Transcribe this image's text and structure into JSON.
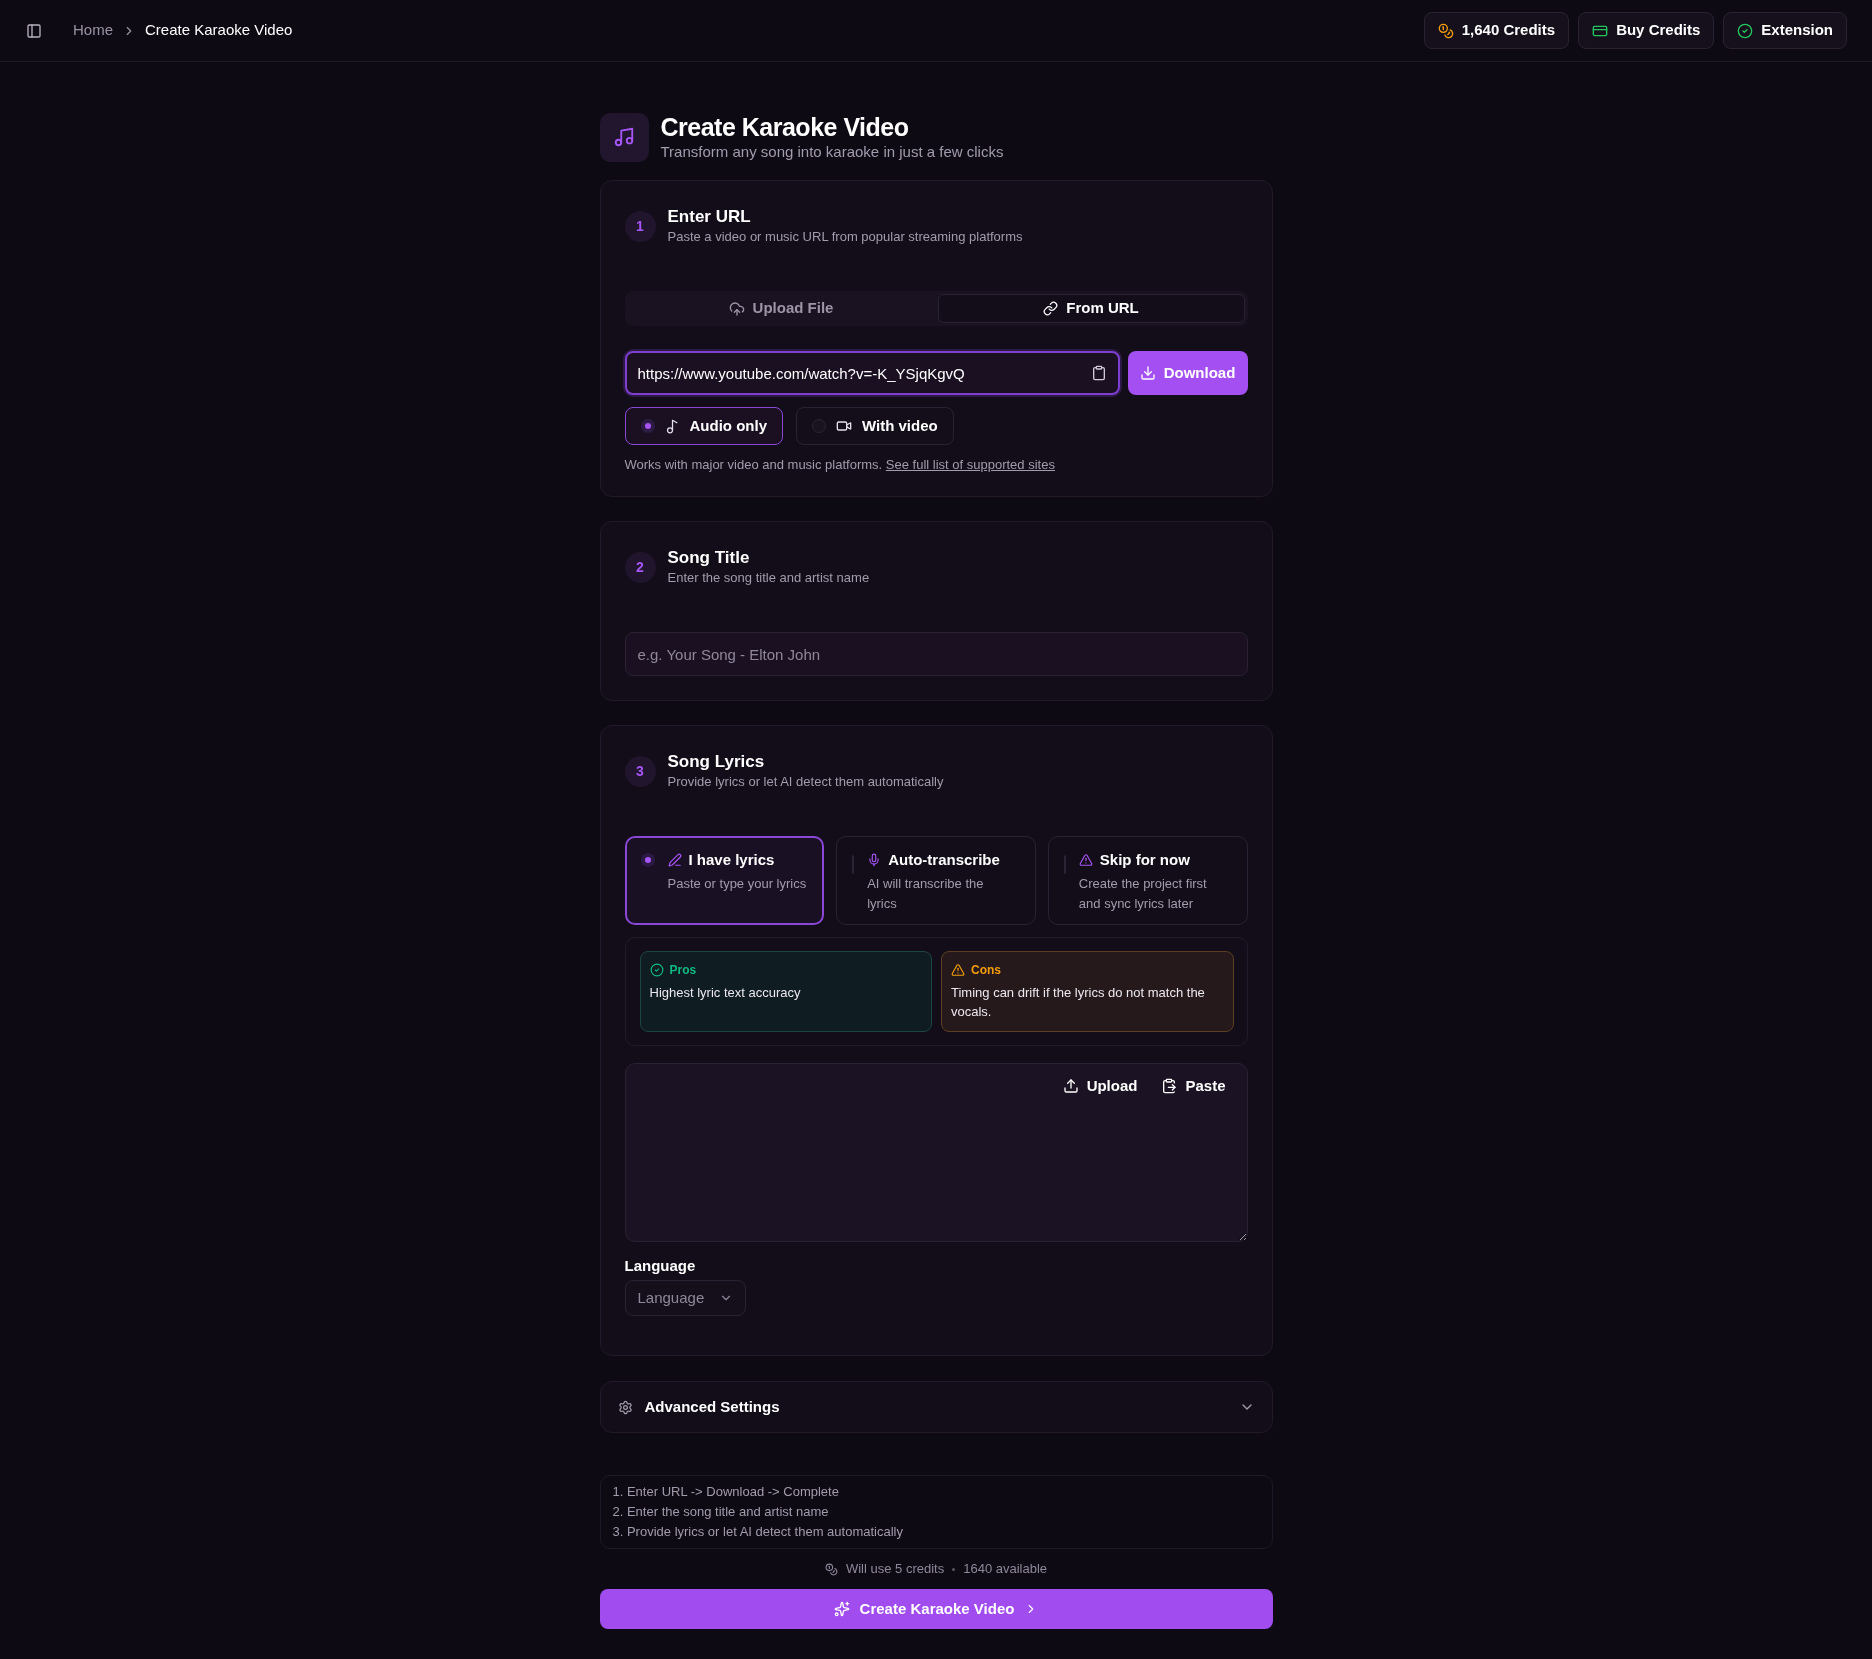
{
  "header": {
    "breadcrumb": [
      {
        "label": "Home",
        "current": false
      },
      {
        "label": "Create Karaoke Video",
        "current": true
      }
    ],
    "actions": [
      {
        "kind": "credits",
        "label": "1,640 Credits"
      },
      {
        "kind": "buy",
        "label": "Buy Credits"
      },
      {
        "kind": "extension",
        "label": "Extension"
      }
    ]
  },
  "page": {
    "title": "Create Karaoke Video",
    "subtitle": "Transform any song into karaoke in just a few clicks"
  },
  "step_url": {
    "number": "1",
    "title": "Enter URL",
    "subtitle": "Paste a video or music URL from popular streaming platforms",
    "tabs": [
      {
        "kind": "upload",
        "label": "Upload File",
        "selected": false
      },
      {
        "kind": "url",
        "label": "From URL",
        "selected": true
      }
    ],
    "url_field": {
      "value": "https://www.youtube.com/watch?v=-K_YSjqKgvQ",
      "focused": true
    },
    "download_button": "Download",
    "formats": [
      {
        "kind": "audio",
        "label": "Audio only",
        "selected": true
      },
      {
        "kind": "video",
        "label": "With video",
        "selected": false
      }
    ],
    "note": "Works with major video and music platforms.",
    "note_link": "See full list of supported sites"
  },
  "step_title": {
    "number": "2",
    "title": "Song Title",
    "subtitle": "Enter the song title and artist name",
    "title_field": {
      "placeholder": "e.g. Your Song - Elton John"
    }
  },
  "step_lyrics": {
    "number": "3",
    "title": "Song Lyrics",
    "subtitle": "Provide lyrics or let AI detect them automatically",
    "options": [
      {
        "kind": "manual",
        "title": "I have lyrics",
        "description": "Paste or type your lyrics",
        "selected": true
      },
      {
        "kind": "transcribe",
        "title": "Auto-transcribe",
        "description": "AI will transcribe the lyrics",
        "selected": false
      },
      {
        "kind": "skip",
        "title": "Skip for now",
        "description": "Create the project first and sync lyrics later",
        "selected": false
      }
    ],
    "pros": {
      "title": "Pros",
      "text": "Highest lyric text accuracy"
    },
    "cons": {
      "title": "Cons",
      "text": "Timing can drift if the lyrics do not match the vocals."
    },
    "lyrics_actions": [
      {
        "kind": "upload",
        "label": "Upload"
      },
      {
        "kind": "paste",
        "label": "Paste"
      }
    ],
    "language": {
      "label": "Language",
      "placeholder": "Language"
    }
  },
  "advanced_settings": {
    "title": "Advanced Settings",
    "expanded": false
  },
  "summary": [
    "1. Enter URL -> Download -> Complete",
    "2. Enter the song title and artist name",
    "3. Provide lyrics or let AI detect them automatically"
  ],
  "credits_note": {
    "usage": "Will use 5 credits",
    "available": "1640 available"
  },
  "submit_button": "Create Karaoke Video"
}
